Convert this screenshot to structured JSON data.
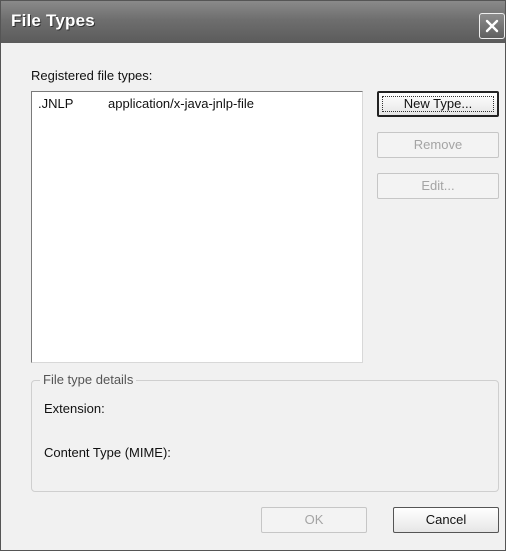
{
  "window": {
    "title": "File Types"
  },
  "list": {
    "label": "Registered file types:",
    "rows": [
      {
        "extension": ".JNLP",
        "mime": "application/x-java-jnlp-file"
      }
    ]
  },
  "buttons": {
    "new_type": "New Type...",
    "remove": "Remove",
    "edit": "Edit...",
    "ok": "OK",
    "cancel": "Cancel"
  },
  "details": {
    "legend": "File type details",
    "extension_label": "Extension:",
    "content_type_label": "Content Type (MIME):"
  },
  "icons": {
    "close": "close-icon"
  }
}
